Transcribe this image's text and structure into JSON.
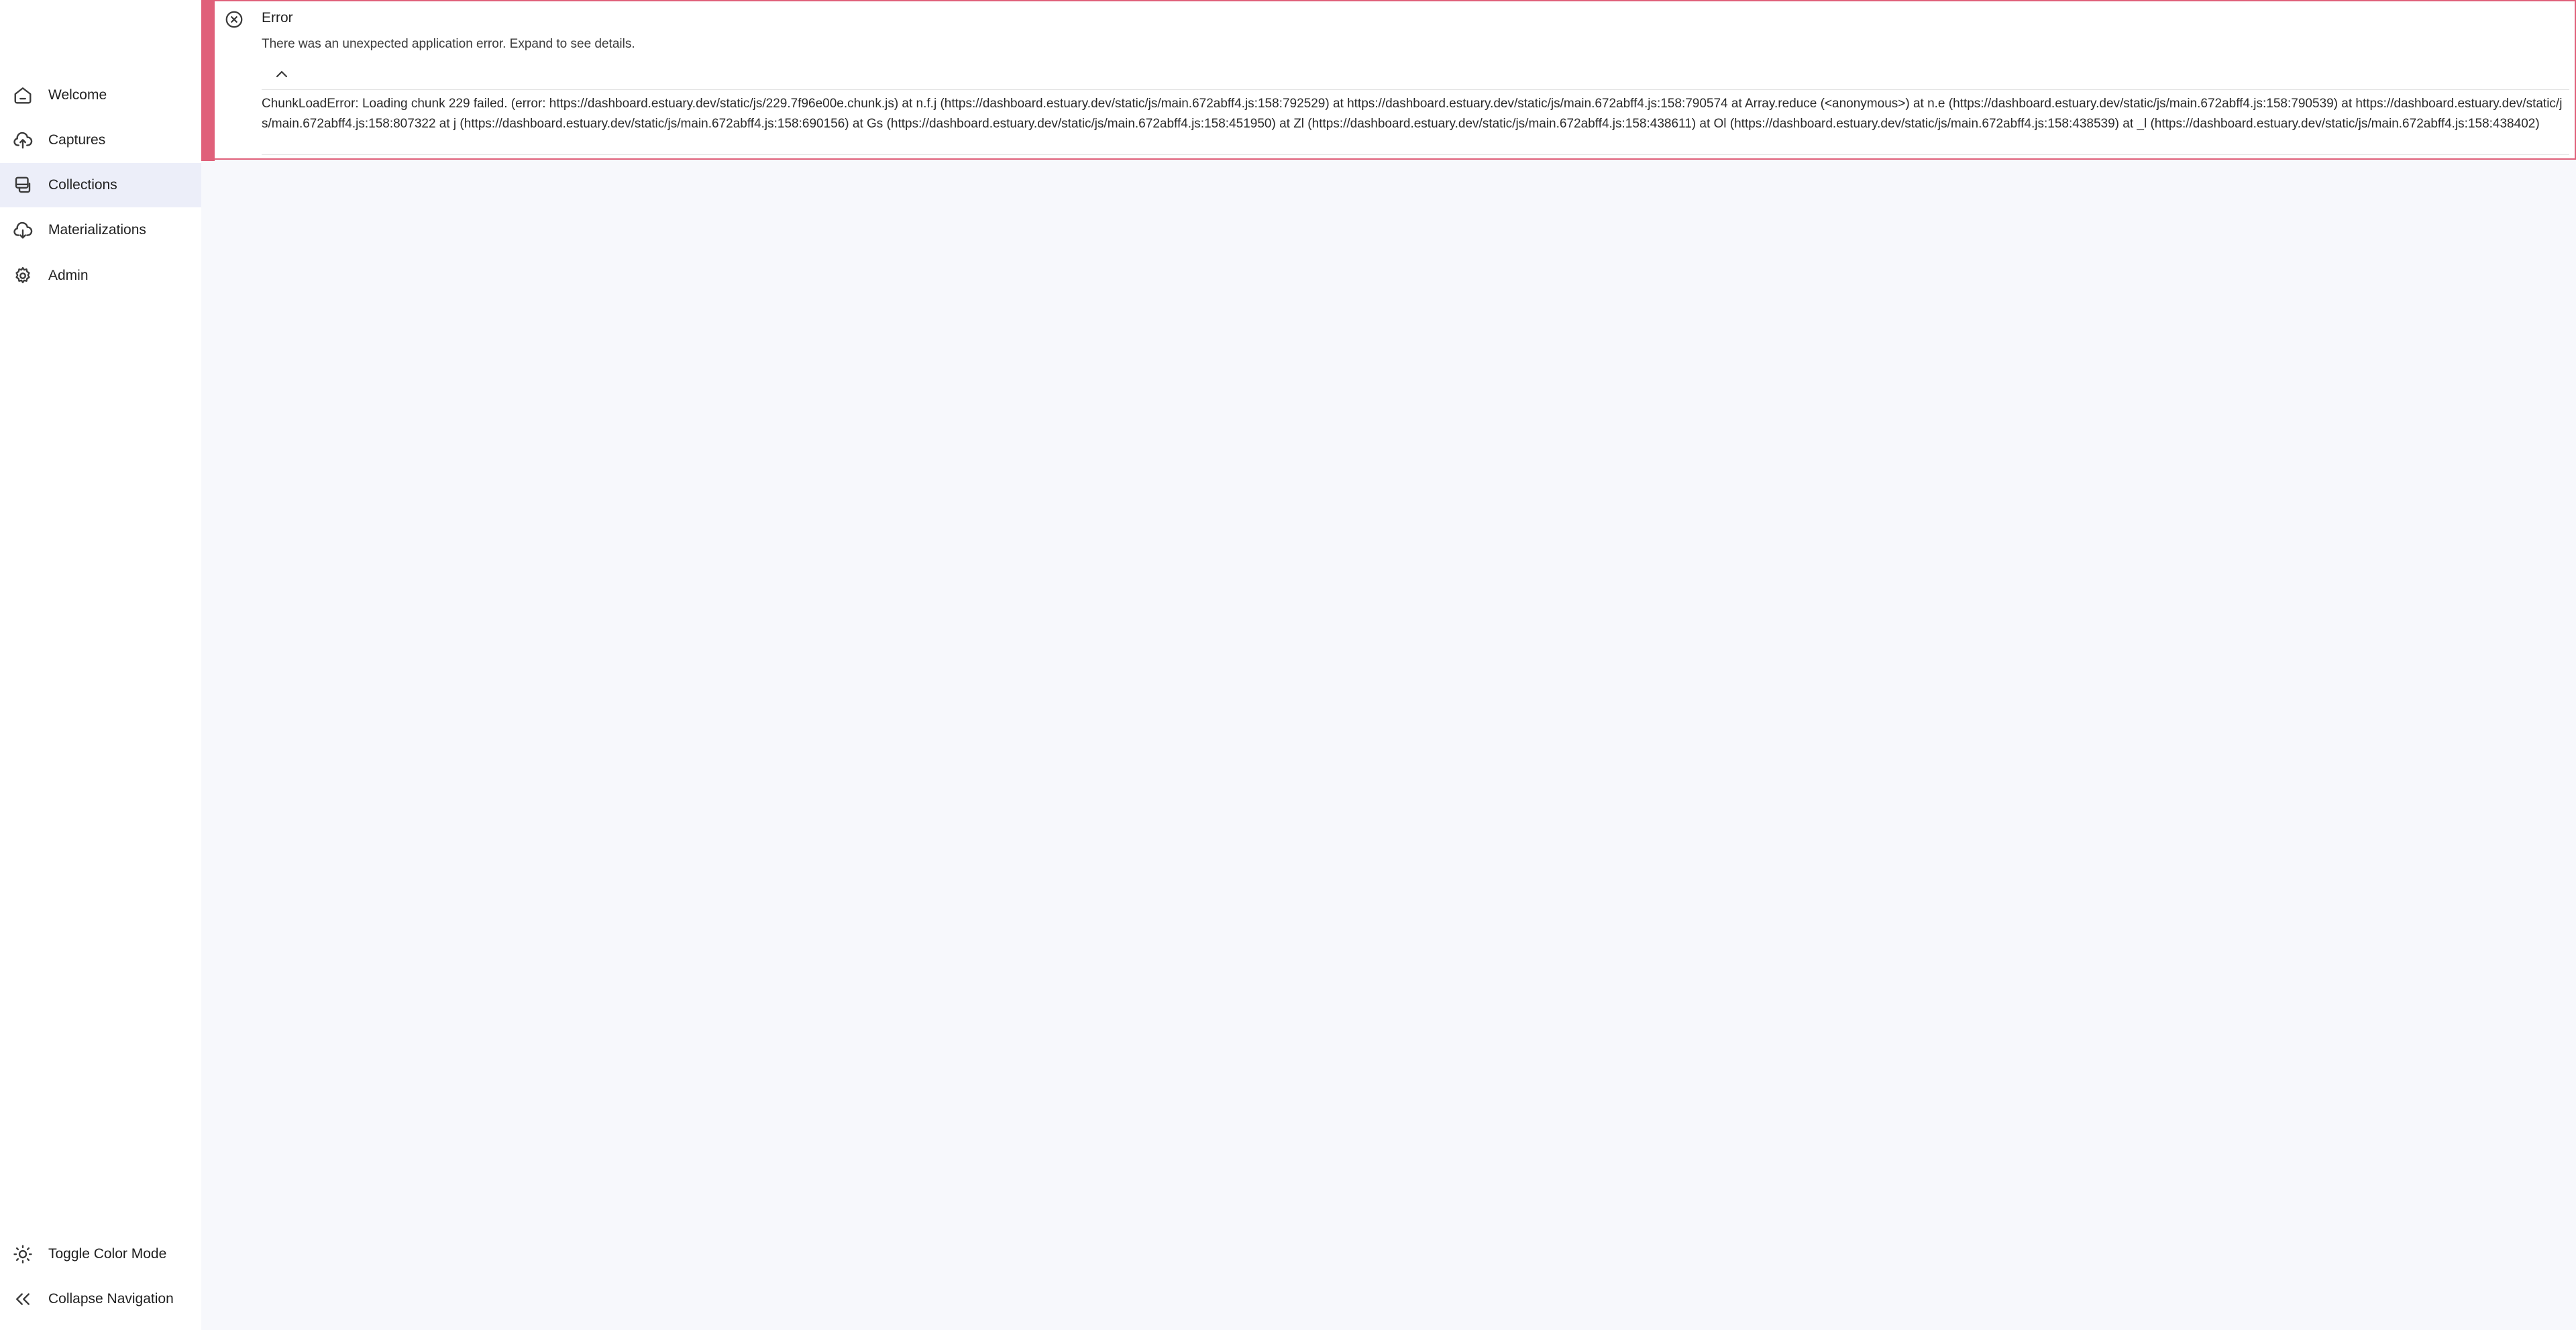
{
  "sidebar": {
    "items": [
      {
        "label": "Welcome",
        "icon": "home-icon"
      },
      {
        "label": "Captures",
        "icon": "cloud-upload-icon"
      },
      {
        "label": "Collections",
        "icon": "collection-icon",
        "active": true
      },
      {
        "label": "Materializations",
        "icon": "cloud-download-icon"
      },
      {
        "label": "Admin",
        "icon": "gear-icon"
      }
    ],
    "bottom": {
      "toggle_color_mode": "Toggle Color Mode",
      "collapse_navigation": "Collapse Navigation"
    }
  },
  "alert": {
    "severity": "error",
    "title": "Error",
    "message": "There was an unexpected application error. Expand to see details.",
    "details": "ChunkLoadError: Loading chunk 229 failed. (error: https://dashboard.estuary.dev/static/js/229.7f96e00e.chunk.js) at n.f.j (https://dashboard.estuary.dev/static/js/main.672abff4.js:158:792529) at https://dashboard.estuary.dev/static/js/main.672abff4.js:158:790574 at Array.reduce (<anonymous>) at n.e (https://dashboard.estuary.dev/static/js/main.672abff4.js:158:790539) at https://dashboard.estuary.dev/static/js/main.672abff4.js:158:807322 at j (https://dashboard.estuary.dev/static/js/main.672abff4.js:158:690156) at Gs (https://dashboard.estuary.dev/static/js/main.672abff4.js:158:451950) at Zl (https://dashboard.estuary.dev/static/js/main.672abff4.js:158:438611) at Ol (https://dashboard.estuary.dev/static/js/main.672abff4.js:158:438539) at _l (https://dashboard.estuary.dev/static/js/main.672abff4.js:158:438402)",
    "accent_color": "#e0607a"
  },
  "theme": {
    "background": "#f7f8fc",
    "sidebar_background": "#ffffff",
    "active_item_background": "#eceef9"
  }
}
